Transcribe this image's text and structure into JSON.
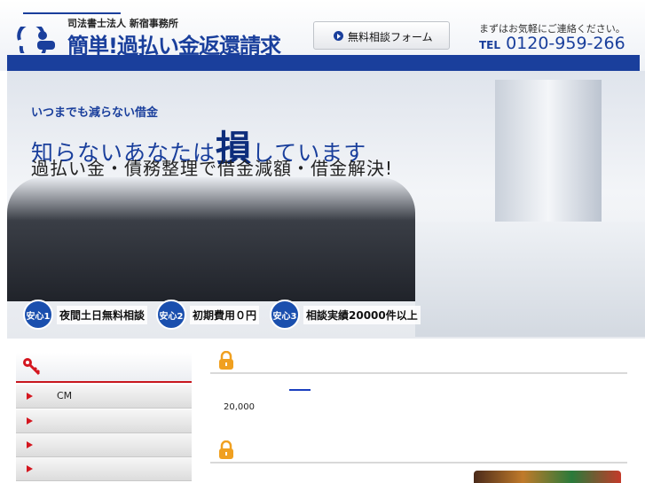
{
  "header": {
    "firm": "司法書士法人 新宿事務所",
    "title": "簡単!過払い金返還請求",
    "form_button": "無料相談フォーム",
    "contact_note": "まずはお気軽にご連絡ください。",
    "tel_label": "TEL",
    "tel_number": "0120-959-266"
  },
  "hero": {
    "tagline": "いつまでも減らない借金",
    "headline_pre": "知らないあなたは",
    "headline_big": "損",
    "headline_post": "しています",
    "subline": "過払い金・債務整理で借金減額・借金解決!",
    "badges": [
      {
        "num": "安心1",
        "text": "夜間土日無料相談"
      },
      {
        "num": "安心2",
        "text": "初期費用０円"
      },
      {
        "num": "安心3",
        "text": "相談実績20000件以上"
      }
    ]
  },
  "sidebar": {
    "items": [
      {
        "label": "CM"
      },
      {
        "label": ""
      },
      {
        "label": ""
      },
      {
        "label": ""
      }
    ]
  },
  "content": {
    "stat": "20,000"
  },
  "colors": {
    "brand_blue": "#1a3f9c",
    "accent_red": "#d4161f",
    "lock_orange": "#f0a020"
  }
}
